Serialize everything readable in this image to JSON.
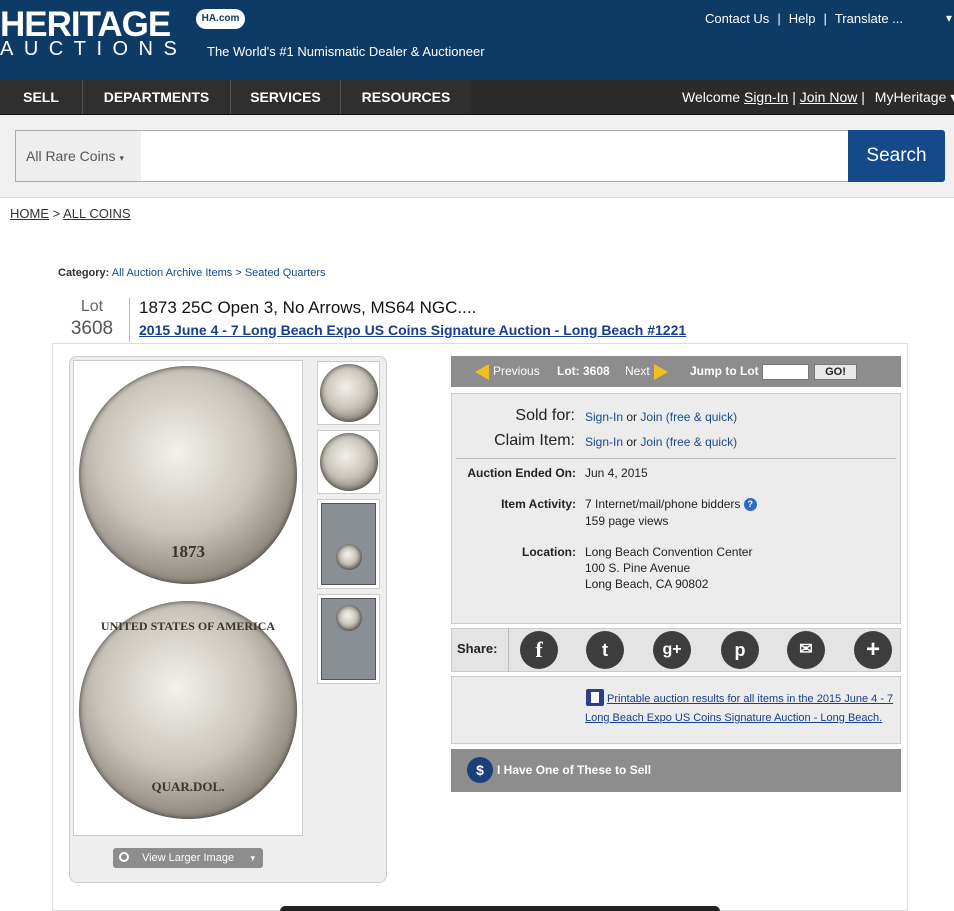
{
  "logo": {
    "top": "HERITAGE",
    "badge": "HA.com",
    "bottom": "AUCTIONS",
    "tagline": "The World's #1 Numismatic Dealer & Auctioneer"
  },
  "toplinks": {
    "contact": "Contact Us",
    "help": "Help",
    "translate": "Translate ...",
    "sep": "|",
    "caret": "▾"
  },
  "nav": {
    "items": [
      {
        "label": "SELL"
      },
      {
        "label": "DEPARTMENTS"
      },
      {
        "label": "SERVICES"
      },
      {
        "label": "RESOURCES"
      }
    ]
  },
  "welcome": {
    "prefix": "Welcome",
    "signin": "Sign-In",
    "sep": "|",
    "join": "Join Now",
    "sep2": "|",
    "myheritage": "MyHeritage ▾"
  },
  "search": {
    "category": "All Rare Coins",
    "caret": "▾",
    "button": "Search",
    "value": ""
  },
  "breadcrumb": {
    "home": "HOME",
    "sep": ">",
    "all": "ALL COINS"
  },
  "category": {
    "label": "Category:",
    "link1": "All Auction Archive Items",
    "sep": ">",
    "link2": "Seated Quarters"
  },
  "lot": {
    "label": "Lot",
    "number": "3608",
    "title": "1873 25C Open 3, No Arrows, MS64 NGC....",
    "auction": "2015 June 4 - 7 Long Beach Expo US Coins Signature Auction - Long Beach #1221"
  },
  "coin": {
    "year": "1873",
    "legend": "UNITED STATES OF AMERICA",
    "denom": "QUAR.DOL."
  },
  "image_viewer": {
    "view_larger": "View Larger Image",
    "caret": "▾",
    "zoom_icon": "search-icon"
  },
  "lotnav": {
    "previous": "Previous",
    "lot": "Lot: 3608",
    "next": "Next",
    "jump": "Jump to Lot",
    "go": "GO!",
    "jump_value": ""
  },
  "info": {
    "sold_label": "Sold for:",
    "claim_label": "Claim Item:",
    "signin": "Sign-In",
    "or": "or",
    "join": "Join (free & quick)",
    "ended_label": "Auction Ended On:",
    "ended": "Jun 4, 2015",
    "activity_label": "Item Activity:",
    "bidders": "7 Internet/mail/phone bidders",
    "help_mark": "?",
    "views": "159 page views",
    "location_label": "Location:",
    "loc1": "Long Beach Convention Center",
    "loc2": "100 S. Pine Avenue",
    "loc3": "Long Beach, CA 90802"
  },
  "share": {
    "label": "Share:",
    "icons": [
      "facebook-icon",
      "twitter-icon",
      "google-plus-icon",
      "pinterest-icon",
      "email-icon",
      "plus-icon"
    ],
    "glyphs": {
      "fb": "f",
      "tw": "t",
      "gp": "g+",
      "pin": "p",
      "mail": "✉",
      "plus": "+"
    }
  },
  "printable": {
    "text": "Printable auction results for all items in the 2015 June 4 - 7 Long Beach Expo US Coins Signature Auction - Long Beach."
  },
  "sell": {
    "dollar": "$",
    "text": "I Have One of These to Sell"
  },
  "colors": {
    "header": "#0e3a66",
    "nav": "#2b2b2b",
    "search_button": "#14498a",
    "panel_gray": "#8d8d8d",
    "link": "#1a3d8f"
  }
}
